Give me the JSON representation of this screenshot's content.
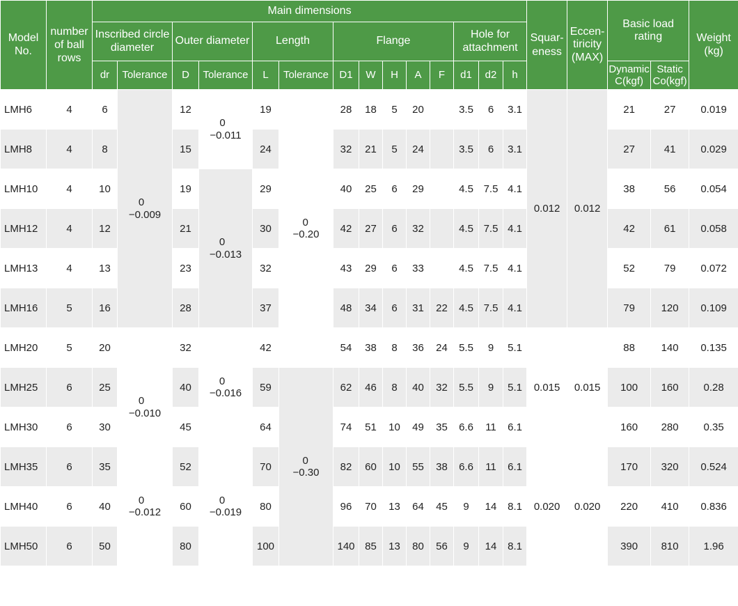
{
  "header": {
    "model_no": "Model No.",
    "ball_rows": "number of ball rows",
    "main_dimensions": "Main dimensions",
    "inscribed": "Inscribed circle diameter",
    "outer": "Outer diameter",
    "length": "Length",
    "flange": "Flange",
    "hole": "Hole for attachment",
    "squareness": "Squar- eness",
    "eccentricity": "Eccen- tiricity (MAX)",
    "load": "Basic load rating",
    "weight": "Weight (kg)",
    "dr": "dr",
    "tolerance": "Tolerance",
    "D": "D",
    "L": "L",
    "D1": "D1",
    "W": "W",
    "H": "H",
    "A": "A",
    "F": "F",
    "d1": "d1",
    "d2": "d2",
    "h": "h",
    "dynamic": "Dynamic C(kgf)",
    "static": "Static Co(kgf)"
  },
  "rows": [
    {
      "model": "LMH6",
      "ball_rows": "4",
      "dr": "6",
      "D": "12",
      "L": "19",
      "D1": "28",
      "W": "18",
      "H": "5",
      "A": "20",
      "F": "",
      "d1": "3.5",
      "d2": "6",
      "h": "3.1",
      "dynamic": "21",
      "static": "27",
      "weight": "0.019"
    },
    {
      "model": "LMH8",
      "ball_rows": "4",
      "dr": "8",
      "D": "15",
      "L": "24",
      "D1": "32",
      "W": "21",
      "H": "5",
      "A": "24",
      "F": "",
      "d1": "3.5",
      "d2": "6",
      "h": "3.1",
      "dynamic": "27",
      "static": "41",
      "weight": "0.029"
    },
    {
      "model": "LMH10",
      "ball_rows": "4",
      "dr": "10",
      "D": "19",
      "L": "29",
      "D1": "40",
      "W": "25",
      "H": "6",
      "A": "29",
      "F": "",
      "d1": "4.5",
      "d2": "7.5",
      "h": "4.1",
      "dynamic": "38",
      "static": "56",
      "weight": "0.054"
    },
    {
      "model": "LMH12",
      "ball_rows": "4",
      "dr": "12",
      "D": "21",
      "L": "30",
      "D1": "42",
      "W": "27",
      "H": "6",
      "A": "32",
      "F": "",
      "d1": "4.5",
      "d2": "7.5",
      "h": "4.1",
      "dynamic": "42",
      "static": "61",
      "weight": "0.058"
    },
    {
      "model": "LMH13",
      "ball_rows": "4",
      "dr": "13",
      "D": "23",
      "L": "32",
      "D1": "43",
      "W": "29",
      "H": "6",
      "A": "33",
      "F": "",
      "d1": "4.5",
      "d2": "7.5",
      "h": "4.1",
      "dynamic": "52",
      "static": "79",
      "weight": "0.072"
    },
    {
      "model": "LMH16",
      "ball_rows": "5",
      "dr": "16",
      "D": "28",
      "L": "37",
      "D1": "48",
      "W": "34",
      "H": "6",
      "A": "31",
      "F": "22",
      "d1": "4.5",
      "d2": "7.5",
      "h": "4.1",
      "dynamic": "79",
      "static": "120",
      "weight": "0.109"
    },
    {
      "model": "LMH20",
      "ball_rows": "5",
      "dr": "20",
      "D": "32",
      "L": "42",
      "D1": "54",
      "W": "38",
      "H": "8",
      "A": "36",
      "F": "24",
      "d1": "5.5",
      "d2": "9",
      "h": "5.1",
      "dynamic": "88",
      "static": "140",
      "weight": "0.135"
    },
    {
      "model": "LMH25",
      "ball_rows": "6",
      "dr": "25",
      "D": "40",
      "L": "59",
      "D1": "62",
      "W": "46",
      "H": "8",
      "A": "40",
      "F": "32",
      "d1": "5.5",
      "d2": "9",
      "h": "5.1",
      "dynamic": "100",
      "static": "160",
      "weight": "0.28"
    },
    {
      "model": "LMH30",
      "ball_rows": "6",
      "dr": "30",
      "D": "45",
      "L": "64",
      "D1": "74",
      "W": "51",
      "H": "10",
      "A": "49",
      "F": "35",
      "d1": "6.6",
      "d2": "11",
      "h": "6.1",
      "dynamic": "160",
      "static": "280",
      "weight": "0.35"
    },
    {
      "model": "LMH35",
      "ball_rows": "6",
      "dr": "35",
      "D": "52",
      "L": "70",
      "D1": "82",
      "W": "60",
      "H": "10",
      "A": "55",
      "F": "38",
      "d1": "6.6",
      "d2": "11",
      "h": "6.1",
      "dynamic": "170",
      "static": "320",
      "weight": "0.524"
    },
    {
      "model": "LMH40",
      "ball_rows": "6",
      "dr": "40",
      "D": "60",
      "L": "80",
      "D1": "96",
      "W": "70",
      "H": "13",
      "A": "64",
      "F": "45",
      "d1": "9",
      "d2": "14",
      "h": "8.1",
      "dynamic": "220",
      "static": "410",
      "weight": "0.836"
    },
    {
      "model": "LMH50",
      "ball_rows": "6",
      "dr": "50",
      "D": "80",
      "L": "100",
      "D1": "140",
      "W": "85",
      "H": "13",
      "A": "80",
      "F": "56",
      "d1": "9",
      "d2": "14",
      "h": "8.1",
      "dynamic": "390",
      "static": "810",
      "weight": "1.96"
    }
  ],
  "merged": {
    "dr_tol_1": {
      "upper": "0",
      "lower": "−0.009"
    },
    "dr_tol_2": {
      "upper": "0",
      "lower": "−0.010"
    },
    "dr_tol_3": {
      "upper": "0",
      "lower": "−0.012"
    },
    "D_tol_1": {
      "upper": "0",
      "lower": "−0.011"
    },
    "D_tol_2": {
      "upper": "0",
      "lower": "−0.013"
    },
    "D_tol_3": {
      "upper": "0",
      "lower": "−0.016"
    },
    "D_tol_4": {
      "upper": "0",
      "lower": "−0.019"
    },
    "L_tol_1": {
      "upper": "0",
      "lower": "−0.20"
    },
    "L_tol_2": {
      "upper": "0",
      "lower": "−0.30"
    },
    "squareness_1": "0.012",
    "squareness_2": "0.015",
    "squareness_3": "0.020",
    "eccentricity_1": "0.012",
    "eccentricity_2": "0.015",
    "eccentricity_3": "0.020"
  },
  "colors": {
    "header_green": "#4e9a47",
    "row_grey": "#ebebeb",
    "row_white": "#ffffff"
  }
}
